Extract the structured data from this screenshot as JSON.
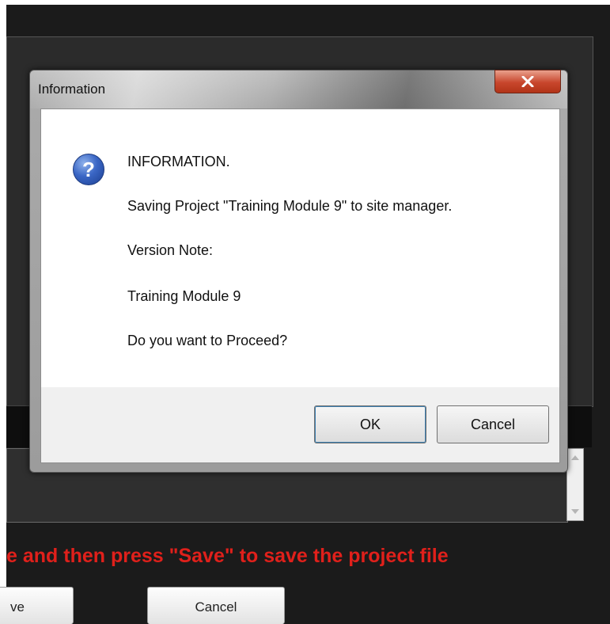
{
  "background": {
    "instruction_text": "e and then press \"Save\" to save the project file",
    "save_button_label": "ve",
    "cancel_button_label": "Cancel"
  },
  "dialog": {
    "title": "Information",
    "icon": "question-icon",
    "heading": "INFORMATION.",
    "message": "Saving Project \"Training Module 9\" to site manager.",
    "version_note_label": "Version Note:",
    "version_note_value": "Training Module 9",
    "question": "Do you want to Proceed?",
    "ok_label": "OK",
    "cancel_label": "Cancel"
  },
  "colors": {
    "instruction_red": "#e0201b",
    "close_button_red": "#c8462c"
  }
}
